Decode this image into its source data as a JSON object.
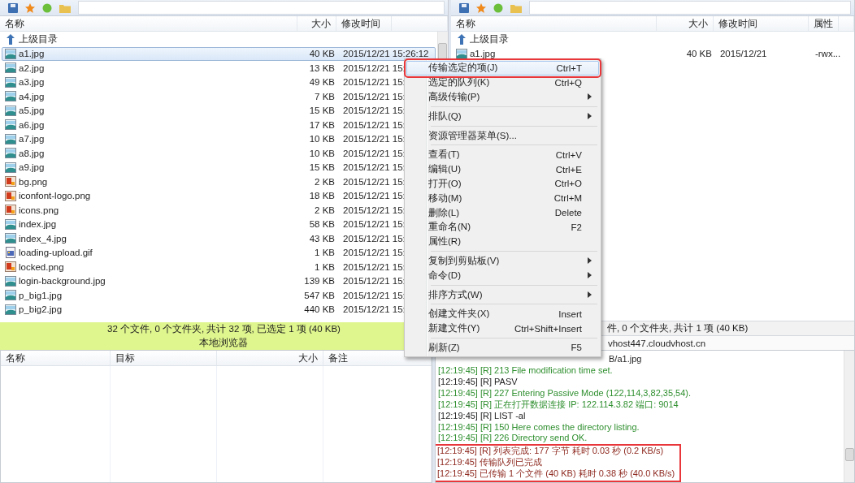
{
  "local_pane": {
    "columns": [
      "名称",
      "大小",
      "修改时间"
    ],
    "rows": [
      {
        "kind": "up",
        "name": "上级目录",
        "selected": false
      },
      {
        "kind": "jpg",
        "name": "a1.jpg",
        "size": "40 KB",
        "modified": "2015/12/21 15:26:12",
        "selected": true
      },
      {
        "kind": "jpg",
        "name": "a2.jpg",
        "size": "13 KB",
        "modified": "2015/12/21 15:",
        "selected": false
      },
      {
        "kind": "jpg",
        "name": "a3.jpg",
        "size": "49 KB",
        "modified": "2015/12/21 15:",
        "selected": false
      },
      {
        "kind": "jpg",
        "name": "a4.jpg",
        "size": "7 KB",
        "modified": "2015/12/21 15:",
        "selected": false
      },
      {
        "kind": "jpg",
        "name": "a5.jpg",
        "size": "15 KB",
        "modified": "2015/12/21 15:",
        "selected": false
      },
      {
        "kind": "jpg",
        "name": "a6.jpg",
        "size": "17 KB",
        "modified": "2015/12/21 15:",
        "selected": false
      },
      {
        "kind": "jpg",
        "name": "a7.jpg",
        "size": "10 KB",
        "modified": "2015/12/21 15:",
        "selected": false
      },
      {
        "kind": "jpg",
        "name": "a8.jpg",
        "size": "10 KB",
        "modified": "2015/12/21 15:",
        "selected": false
      },
      {
        "kind": "jpg",
        "name": "a9.jpg",
        "size": "15 KB",
        "modified": "2015/12/21 15:",
        "selected": false
      },
      {
        "kind": "png",
        "name": "bg.png",
        "size": "2 KB",
        "modified": "2015/12/21 15:",
        "selected": false
      },
      {
        "kind": "png",
        "name": "iconfont-logo.png",
        "size": "18 KB",
        "modified": "2015/12/21 15:",
        "selected": false
      },
      {
        "kind": "png",
        "name": "icons.png",
        "size": "2 KB",
        "modified": "2015/12/21 15:",
        "selected": false
      },
      {
        "kind": "jpg",
        "name": "index.jpg",
        "size": "58 KB",
        "modified": "2015/12/21 15:",
        "selected": false
      },
      {
        "kind": "jpg",
        "name": "index_4.jpg",
        "size": "43 KB",
        "modified": "2015/12/21 15:",
        "selected": false
      },
      {
        "kind": "gif",
        "name": "loading-upload.gif",
        "size": "1 KB",
        "modified": "2015/12/21 15:",
        "selected": false
      },
      {
        "kind": "png",
        "name": "locked.png",
        "size": "1 KB",
        "modified": "2015/12/21 15:",
        "selected": false
      },
      {
        "kind": "jpg",
        "name": "login-background.jpg",
        "size": "139 KB",
        "modified": "2015/12/21 15:",
        "selected": false
      },
      {
        "kind": "jpg",
        "name": "p_big1.jpg",
        "size": "547 KB",
        "modified": "2015/12/21 15:",
        "selected": false
      },
      {
        "kind": "jpg",
        "name": "p_big2.jpg",
        "size": "440 KB",
        "modified": "2015/12/21 15:",
        "selected": false
      }
    ],
    "status": "32 个文件, 0 个文件夹, 共计 32 项, 已选定 1 项 (40 KB)",
    "title": "本地浏览器"
  },
  "remote_pane": {
    "columns": [
      "名称",
      "大小",
      "修改时间",
      "属性"
    ],
    "rows": [
      {
        "kind": "up",
        "name": "上级目录",
        "selected": false
      },
      {
        "kind": "jpg",
        "name": "a1.jpg",
        "size": "40 KB",
        "modified": "2015/12/21",
        "attributes": "-rwx...",
        "selected": false
      }
    ],
    "status": "件, 0 个文件夹, 共计 1 项 (40 KB)",
    "title": "vhost447.cloudvhost.cn"
  },
  "queue": {
    "columns": [
      "名称",
      "目标",
      "大小",
      "备注"
    ]
  },
  "log": {
    "lines": [
      {
        "kind": "partial",
        "text": "B/a1.jpg"
      },
      {
        "kind": "response",
        "text": "[12:19:45]  [R] 213 File modification time set."
      },
      {
        "kind": "command",
        "text": "[12:19:45]  [R] PASV"
      },
      {
        "kind": "response",
        "text": "[12:19:45]  [R] 227 Entering Passive Mode (122,114,3,82,35,54)."
      },
      {
        "kind": "response",
        "text": "[12:19:45]  [R] 正在打开数据连接 IP: 122.114.3.82 端口: 9014"
      },
      {
        "kind": "command",
        "text": "[12:19:45]  [R] LIST -al"
      },
      {
        "kind": "response",
        "text": "[12:19:45]  [R] 150 Here comes the directory listing."
      },
      {
        "kind": "response",
        "text": "[12:19:45]  [R] 226 Directory send OK."
      }
    ],
    "highlighted_lines": [
      {
        "kind": "status",
        "text": "[12:19:45]  [R] 列表完成: 177 字节 耗时 0.03 秒 (0.2 KB/s)"
      },
      {
        "kind": "status",
        "text": "[12:19:45]  传输队列已完成"
      },
      {
        "kind": "status",
        "text": "[12:19:45]  已传输 1 个文件 (40 KB) 耗时 0.38 秒 (40.0 KB/s)"
      }
    ]
  },
  "context_menu": {
    "groups": [
      [
        {
          "label": "传输选定的项(J)",
          "shortcut": "Ctrl+T",
          "submenu": false,
          "selected": true,
          "annotated": true
        },
        {
          "label": "选定的队列(K)",
          "shortcut": "Ctrl+Q",
          "submenu": false,
          "selected": false,
          "annotated": false
        },
        {
          "label": "高级传输(P)",
          "submenu": true,
          "selected": false,
          "annotated": false
        }
      ],
      [
        {
          "label": "排队(Q)",
          "submenu": true,
          "selected": false,
          "annotated": false
        }
      ],
      [
        {
          "label": "资源管理器菜单(S)...",
          "submenu": false,
          "selected": false,
          "annotated": false
        }
      ],
      [
        {
          "label": "查看(T)",
          "shortcut": "Ctrl+V",
          "submenu": false,
          "selected": false,
          "annotated": false
        },
        {
          "label": "编辑(U)",
          "shortcut": "Ctrl+E",
          "submenu": false,
          "selected": false,
          "annotated": false
        },
        {
          "label": "打开(O)",
          "shortcut": "Ctrl+O",
          "submenu": false,
          "selected": false,
          "annotated": false
        },
        {
          "label": "移动(M)",
          "shortcut": "Ctrl+M",
          "submenu": false,
          "selected": false,
          "annotated": false
        },
        {
          "label": "删除(L)",
          "shortcut": "Delete",
          "submenu": false,
          "selected": false,
          "annotated": false
        },
        {
          "label": "重命名(N)",
          "shortcut": "F2",
          "submenu": false,
          "selected": false,
          "annotated": false
        },
        {
          "label": "属性(R)",
          "submenu": false,
          "selected": false,
          "annotated": false
        }
      ],
      [
        {
          "label": "复制到剪贴板(V)",
          "submenu": true,
          "selected": false,
          "annotated": false
        },
        {
          "label": "命令(D)",
          "submenu": true,
          "selected": false,
          "annotated": false
        }
      ],
      [
        {
          "label": "排序方式(W)",
          "submenu": true,
          "selected": false,
          "annotated": false
        }
      ],
      [
        {
          "label": "创建文件夹(X)",
          "shortcut": "Insert",
          "submenu": false,
          "selected": false,
          "annotated": false
        },
        {
          "label": "新建文件(Y)",
          "shortcut": "Ctrl+Shift+Insert",
          "submenu": false,
          "selected": false,
          "annotated": false
        }
      ],
      [
        {
          "label": "刷新(Z)",
          "shortcut": "F5",
          "submenu": false,
          "selected": false,
          "annotated": false
        }
      ]
    ]
  }
}
